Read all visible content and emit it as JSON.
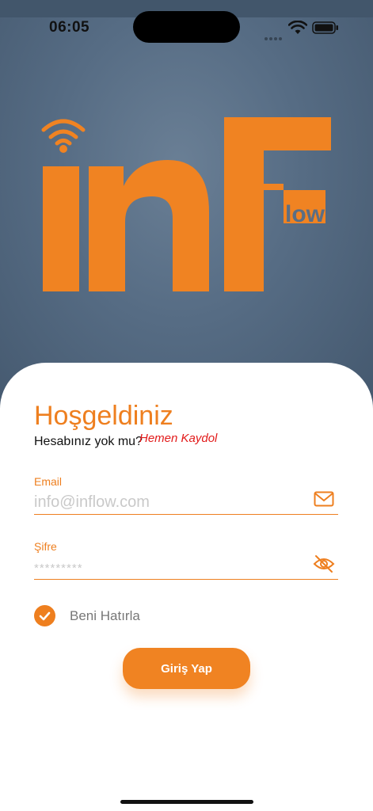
{
  "status_bar": {
    "time": "06:05"
  },
  "brand": {
    "main": "inF",
    "sub": "low"
  },
  "welcome": {
    "title": "Hoşgeldiniz",
    "no_account": "Hesabınız yok mu?",
    "register_link": "Hemen Kaydol"
  },
  "email": {
    "label": "Email",
    "placeholder": "info@inflow.com",
    "icon": "mail-icon"
  },
  "password": {
    "label": "Şifre",
    "placeholder": "*********",
    "icon": "eye-off-icon"
  },
  "remember": {
    "label": "Beni Hatırla",
    "checked": true
  },
  "login_button": {
    "label": "Giriş Yap"
  },
  "colors": {
    "accent": "#EE7F1F",
    "link": "#E21A1A",
    "hero": "#566C84"
  }
}
